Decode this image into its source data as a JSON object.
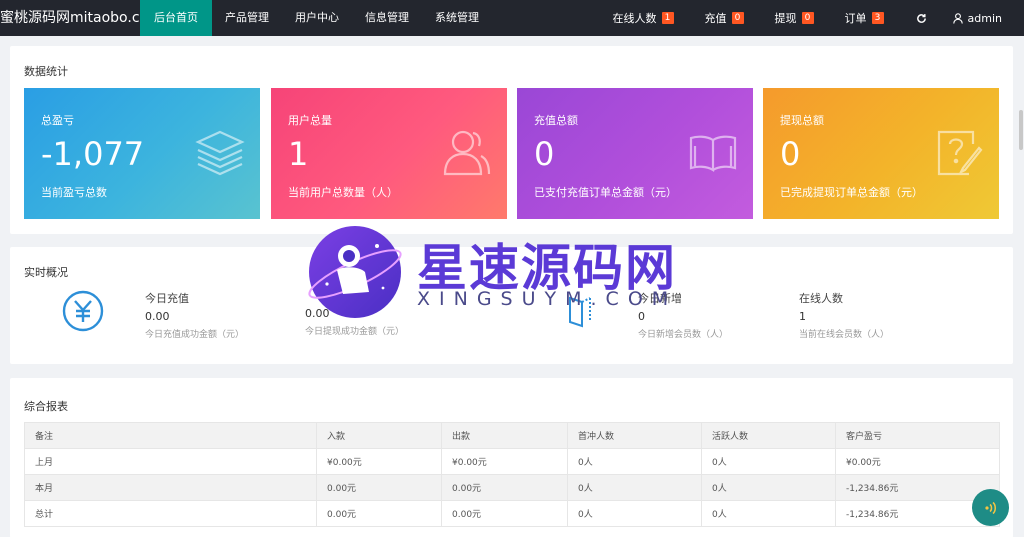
{
  "topbar": {
    "brand": "蜜桃源码网mitaobo.c...",
    "nav": [
      "后台首页",
      "产品管理",
      "用户中心",
      "信息管理",
      "系统管理"
    ],
    "right": [
      {
        "label": "在线人数",
        "badge": "1"
      },
      {
        "label": "充值",
        "badge": "0"
      },
      {
        "label": "提现",
        "badge": "0"
      },
      {
        "label": "订单",
        "badge": "3"
      }
    ],
    "user": "admin",
    "colors": {
      "bar": "#23262e",
      "active": "#009688",
      "badge": "#ff5722"
    }
  },
  "stats": {
    "title": "数据统计",
    "cards": [
      {
        "title": "总盈亏",
        "value": "-1,077",
        "desc": "当前盈亏总数",
        "icon": "layers-icon"
      },
      {
        "title": "用户总量",
        "value": "1",
        "desc": "当前用户总数量（人）",
        "icon": "users-icon"
      },
      {
        "title": "充值总额",
        "value": "0",
        "desc": "已支付充值订单总金额（元）",
        "icon": "book-icon"
      },
      {
        "title": "提现总额",
        "value": "0",
        "desc": "已完成提现订单总金额（元）",
        "icon": "question-note-icon"
      }
    ]
  },
  "realtime": {
    "title": "实时概况",
    "items": [
      {
        "label": "今日充值",
        "value": "0.00",
        "desc": "今日充值成功金额（元）"
      },
      {
        "label": "",
        "value": "0.00",
        "desc": "今日提现成功金额（元）"
      },
      {
        "label": "今日新增",
        "value": "0",
        "desc": "今日新增会员数（人）"
      },
      {
        "label": "在线人数",
        "value": "1",
        "desc": "当前在线会员数（人）"
      }
    ]
  },
  "report": {
    "title": "综合报表",
    "columns": [
      "备注",
      "入款",
      "出款",
      "首冲人数",
      "活跃人数",
      "客户盈亏"
    ],
    "rows": [
      [
        "上月",
        "¥0.00元",
        "¥0.00元",
        "0人",
        "0人",
        "¥0.00元"
      ],
      [
        "本月",
        "0.00元",
        "0.00元",
        "0人",
        "0人",
        "-1,234.86元"
      ],
      [
        "总计",
        "0.00元",
        "0.00元",
        "0人",
        "0人",
        "-1,234.86元"
      ]
    ]
  },
  "watermark": {
    "title": "星速源码网",
    "subtitle": "XINGSUYM.COM"
  }
}
